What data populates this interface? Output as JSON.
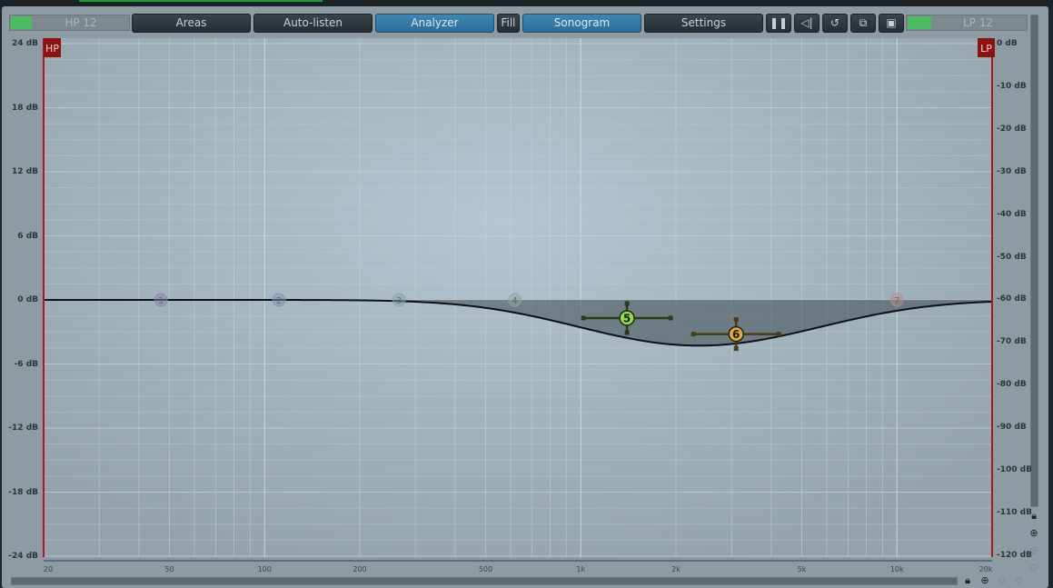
{
  "toolbar": {
    "hp": "HP 12",
    "areas": "Areas",
    "auto_listen": "Auto-listen",
    "analyzer": "Analyzer",
    "fill": "Fill",
    "sonogram": "Sonogram",
    "settings": "Settings",
    "icons": [
      "pause-icon",
      "speaker-icon",
      "reset-icon",
      "copy-icon",
      "paste-icon"
    ],
    "lp": "LP 12"
  },
  "plot": {
    "hp_marker": "HP",
    "lp_marker": "LP",
    "gain_labels": [
      {
        "db": 24,
        "text": "24 dB"
      },
      {
        "db": 18,
        "text": "18 dB"
      },
      {
        "db": 12,
        "text": "12 dB"
      },
      {
        "db": 6,
        "text": "6 dB"
      },
      {
        "db": 0,
        "text": "0 dB"
      },
      {
        "db": -6,
        "text": "-6 dB"
      },
      {
        "db": -12,
        "text": "-12 dB"
      },
      {
        "db": -18,
        "text": "-18 dB"
      },
      {
        "db": -24,
        "text": "-24 dB"
      }
    ],
    "level_labels": [
      "0 dB",
      "-10 dB",
      "-20 dB",
      "-30 dB",
      "-40 dB",
      "-50 dB",
      "-60 dB",
      "-70 dB",
      "-80 dB",
      "-90 dB",
      "-100 dB",
      "-110 dB",
      "-120 dB"
    ],
    "freq_labels": [
      {
        "f": 20,
        "text": "20"
      },
      {
        "f": 50,
        "text": "50"
      },
      {
        "f": 100,
        "text": "100"
      },
      {
        "f": 200,
        "text": "200"
      },
      {
        "f": 500,
        "text": "500"
      },
      {
        "f": 1000,
        "text": "1k"
      },
      {
        "f": 2000,
        "text": "2k"
      },
      {
        "f": 5000,
        "text": "5k"
      },
      {
        "f": 10000,
        "text": "10k"
      },
      {
        "f": 20000,
        "text": "20k"
      }
    ],
    "bands": [
      {
        "label": "1",
        "freq": 47,
        "gain": 0,
        "active": false,
        "color": "#8a7fb0"
      },
      {
        "label": "2",
        "freq": 111,
        "gain": 0,
        "active": false,
        "color": "#7f93b4"
      },
      {
        "label": "3",
        "freq": 266,
        "gain": 0,
        "active": false,
        "color": "#7fa8a8"
      },
      {
        "label": "4",
        "freq": 618,
        "gain": 0,
        "active": false,
        "color": "#8fa89a"
      },
      {
        "label": "5",
        "freq": 1400,
        "gain": -1.7,
        "active": true,
        "color": "#8ee04a"
      },
      {
        "label": "6",
        "freq": 3100,
        "gain": -3.2,
        "active": true,
        "color": "#e2a838"
      },
      {
        "label": "7",
        "freq": 10000,
        "gain": 0,
        "active": false,
        "color": "#b88a90"
      }
    ]
  }
}
